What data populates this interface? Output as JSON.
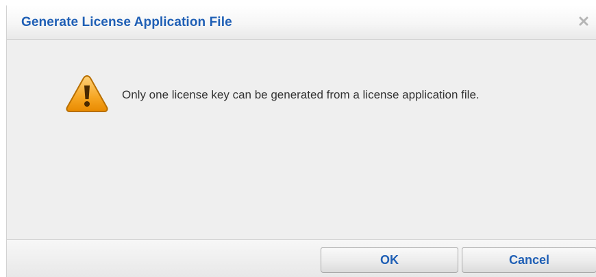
{
  "dialog": {
    "title": "Generate License Application File",
    "close_icon": "close-icon",
    "message": "Only one license key can be generated from a license application file.",
    "message_icon": "warning-icon",
    "buttons": {
      "ok_label": "OK",
      "cancel_label": "Cancel"
    }
  },
  "colors": {
    "title": "#1f5fb5",
    "warning_fill": "#f5a623",
    "warning_border": "#c97a00",
    "background": "#efefef"
  }
}
